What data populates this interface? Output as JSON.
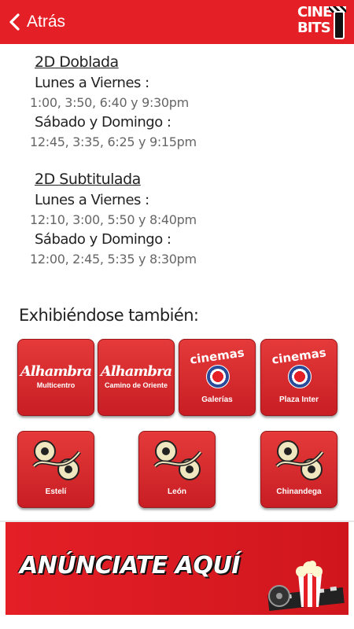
{
  "header": {
    "back_label": "Atrás",
    "logo_line1": "CINE",
    "logo_line2": "BITS"
  },
  "showtimes": [
    {
      "format": "2D Doblada",
      "schedule": [
        {
          "day": "Lunes a Viernes :",
          "times": "1:00, 3:50, 6:40 y 9:30pm"
        },
        {
          "day": "Sábado y Domingo :",
          "times": "12:45, 3:35, 6:25 y 9:15pm"
        }
      ]
    },
    {
      "format": "2D Subtitulada",
      "schedule": [
        {
          "day": "Lunes a Viernes :",
          "times": "12:10, 3:00, 5:50 y 8:40pm"
        },
        {
          "day": "Sábado y Domingo :",
          "times": "12:00, 2:45, 5:35 y 8:30pm"
        }
      ]
    }
  ],
  "also_showing": {
    "title": "Exhibiéndose también:",
    "cinemas": [
      {
        "brand": "Alhambra",
        "label": "Multicentro",
        "logo": "alhambra-logo"
      },
      {
        "brand": "Alhambra",
        "label": "Camino de Oriente",
        "logo": "alhambra-logo"
      },
      {
        "brand": "cinemas",
        "label": "Galerías",
        "logo": "cinemas-globe-logo"
      },
      {
        "brand": "cinemas",
        "label": "Plaza Inter",
        "logo": "cinemas-globe-logo"
      },
      {
        "label": "Estelí",
        "logo": "film-reel-logo"
      },
      {
        "label": "León",
        "logo": "film-reel-logo"
      },
      {
        "label": "Chinandega",
        "logo": "film-reel-logo"
      }
    ]
  },
  "ad": {
    "text": "ANÚNCIATE AQUÍ",
    "art": "popcorn-film-icon"
  },
  "colors": {
    "accent": "#e41f26"
  }
}
